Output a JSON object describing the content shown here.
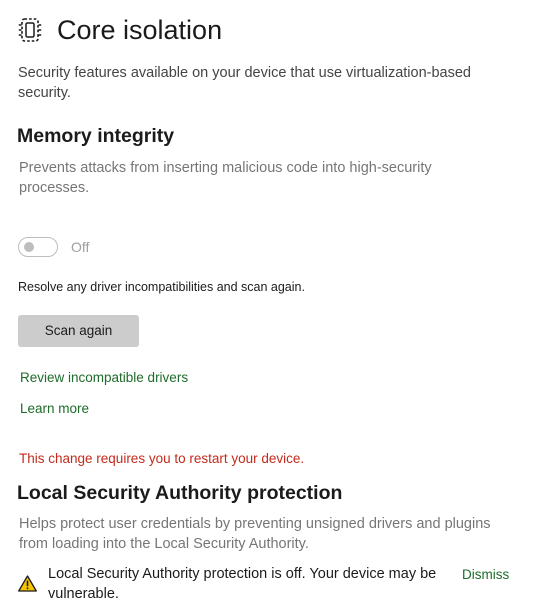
{
  "header": {
    "icon": "core-isolation-chip-icon",
    "title": "Core isolation"
  },
  "page": {
    "description": "Security features available on your device that use virtualization-based security."
  },
  "memory_integrity": {
    "title": "Memory integrity",
    "description": "Prevents attacks from inserting malicious code into high-security processes.",
    "toggle_state": "Off",
    "toggle_on": false,
    "resolve_text": "Resolve any driver incompatibilities and scan again.",
    "scan_button_label": "Scan again",
    "review_link": "Review incompatible drivers",
    "learn_more_link": "Learn more",
    "restart_warning": "This change requires you to restart your device."
  },
  "lsa": {
    "title": "Local Security Authority protection",
    "description": "Helps protect user credentials by preventing unsigned drivers and plugins from loading into the Local Security Authority.",
    "warning_icon": "warning-icon",
    "warning_text": "Local Security Authority protection is off. Your device may be vulnerable.",
    "dismiss_link": "Dismiss"
  },
  "colors": {
    "link": "#1e6b2a",
    "error": "#c42b1c",
    "button_bg": "#cccccc",
    "warning": "#f7c500"
  }
}
